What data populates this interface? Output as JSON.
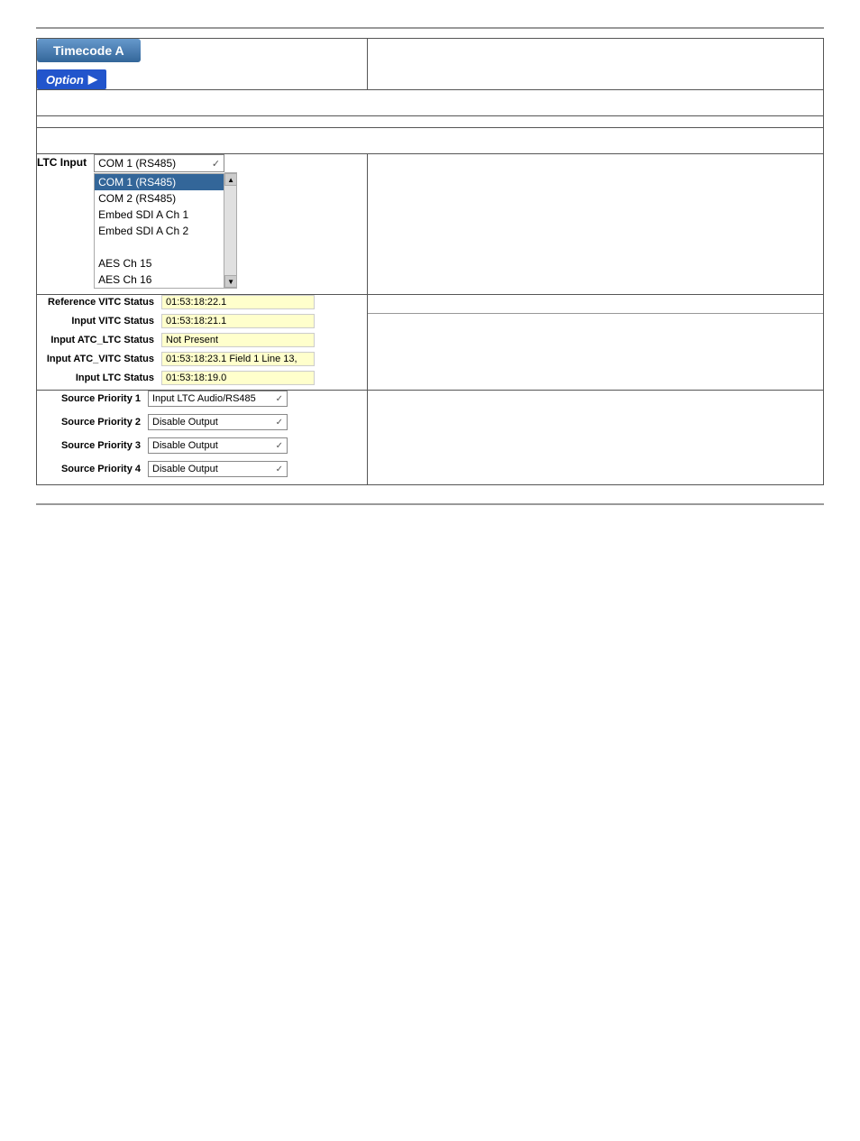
{
  "page": {
    "top_rule": true,
    "bottom_rule": true
  },
  "header": {
    "timecode_label": "Timecode A",
    "option_label": "Option",
    "option_icon": "→"
  },
  "row2": {
    "content": ""
  },
  "row3": {
    "content": ""
  },
  "row4": {
    "content": ""
  },
  "ltc_section": {
    "label": "LTC Input",
    "selected_value": "COM 1 (RS485)",
    "dropdown_items": [
      {
        "label": "COM 1 (RS485)",
        "selected": true
      },
      {
        "label": "COM 2 (RS485)",
        "selected": false
      },
      {
        "label": "Embed SDI A Ch 1",
        "selected": false
      },
      {
        "label": "Embed SDI A Ch 2",
        "selected": false
      },
      {
        "label": "",
        "selected": false
      },
      {
        "label": "AES Ch 15",
        "selected": false
      },
      {
        "label": "AES Ch 16",
        "selected": false
      }
    ]
  },
  "status_section": {
    "rows": [
      {
        "label": "Reference VITC Status",
        "value": "01:53:18:22.1"
      },
      {
        "label": "Input VITC Status",
        "value": "01:53:18:21.1"
      },
      {
        "label": "Input ATC_LTC Status",
        "value": "Not Present"
      },
      {
        "label": "Input ATC_VITC Status",
        "value": "01:53:18:23.1 Field 1 Line 13,"
      },
      {
        "label": "Input LTC Status",
        "value": "01:53:18:19.0"
      }
    ]
  },
  "priority_section": {
    "rows": [
      {
        "label": "Source Priority 1",
        "value": "Input LTC Audio/RS485"
      },
      {
        "label": "Source Priority 2",
        "value": "Disable Output"
      },
      {
        "label": "Source Priority 3",
        "value": "Disable Output"
      },
      {
        "label": "Source Priority 4",
        "value": "Disable Output"
      }
    ]
  }
}
